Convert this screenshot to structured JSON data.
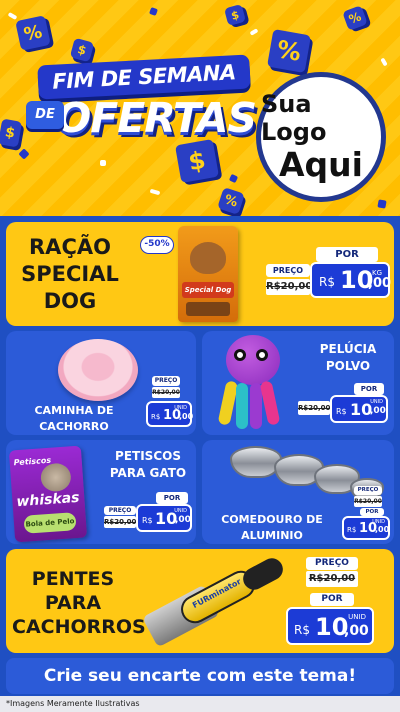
{
  "header": {
    "title_line1": "FIM DE SEMANA",
    "title_de": "DE",
    "title_line2": "OFERTAS",
    "logo_line1": "Sua Logo",
    "logo_line2": "Aqui"
  },
  "products": {
    "racao": {
      "title": "RAÇÃO SPECIAL DOG",
      "discount": "-50%",
      "label_old": "PREÇO",
      "old_price": "R$20,00",
      "label_new": "POR",
      "currency": "R$",
      "price_int": "10",
      "price_cents": ",00",
      "unit": "KG"
    },
    "caminha": {
      "title": "CAMINHA DE CACHORRO",
      "label_old": "PREÇO",
      "old_price": "R$20,00",
      "currency": "R$",
      "price_int": "10",
      "price_cents": ",00",
      "unit": "UNID"
    },
    "pelucia": {
      "title": "PELÚCIA POLVO",
      "label_new": "POR",
      "old_price": "R$20,00",
      "currency": "R$",
      "price_int": "10",
      "price_cents": ",00",
      "unit": "UNID"
    },
    "petiscos": {
      "title": "PETISCOS PARA GATO",
      "label_new": "POR",
      "label_old": "PREÇO",
      "old_price": "R$20,00",
      "currency": "R$",
      "price_int": "10",
      "price_cents": ",00",
      "unit": "UNID",
      "pack_brand": "whiskas",
      "pack_top": "Petiscos",
      "pack_flavor": "Bola de Pelo"
    },
    "comedouro": {
      "title": "COMEDOURO DE ALUMINIO",
      "label_old": "PREÇO",
      "old_price": "R$20,00",
      "label_new": "POR",
      "currency": "R$",
      "price_int": "10",
      "price_cents": ",00",
      "unit": "UNID"
    },
    "pentes": {
      "title": "PENTES PARA CACHORROS",
      "label_old": "PREÇO",
      "old_price": "R$20,00",
      "label_new": "POR",
      "currency": "R$",
      "price_int": "10",
      "price_cents": ",00",
      "unit": "UNID",
      "brush_brand": "FURminator"
    }
  },
  "footer": {
    "cta": "Crie seu encarte com este tema!",
    "disclaimer": "*Imagens Meramente Ilustrativas"
  },
  "colors": {
    "yellow": "#ffc814",
    "blue_card": "#2c5bd8",
    "navy": "#1c3bd6",
    "background": "#1f4fc2"
  }
}
